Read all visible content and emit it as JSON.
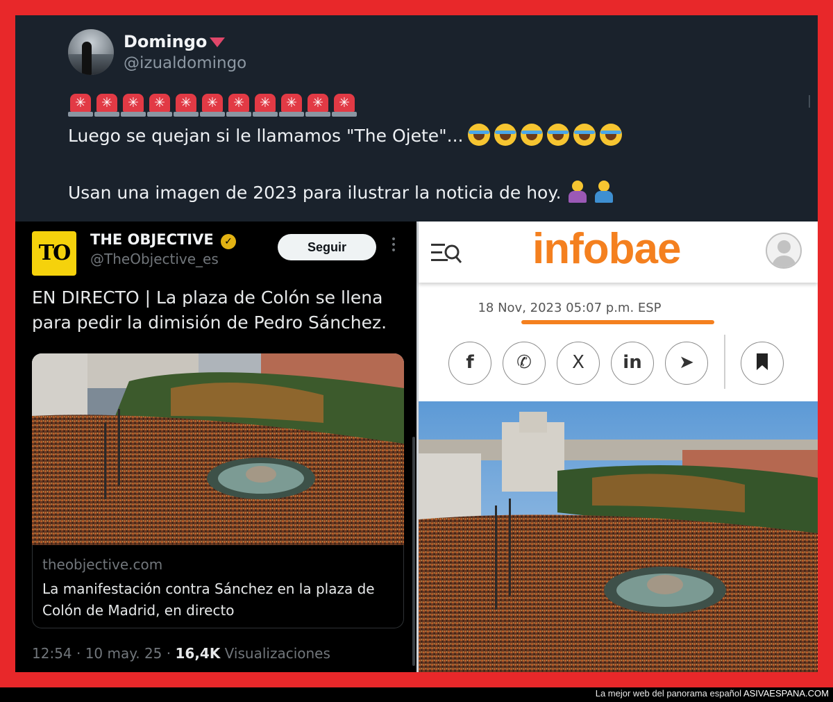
{
  "tweet": {
    "author_name": "Domingo",
    "author_handle": "@izualdomingo",
    "siren_count": 11,
    "line1_text": "Luego se quejan si le llamamos \"The Ojete\"...",
    "laugh_emoji_count": 6,
    "line2_text": "Usan una imagen de 2023 para ilustrar la noticia de hoy."
  },
  "embedded_tweet": {
    "logo_text": "TO",
    "account_name": "THE OBJECTIVE",
    "account_handle": "@TheObjective_es",
    "follow_label": "Seguir",
    "more_icon": "⋮",
    "text": "EN DIRECTO | La plaza de Colón se llena para pedir la dimisión de Pedro Sánchez.",
    "link_domain": "theobjective.com",
    "link_title": "La manifestación contra Sánchez en la plaza de Colón de Madrid, en directo",
    "time_date": "12:54 · 10 may. 25 · ",
    "views_count": "16,4K",
    "views_label": " Visualizaciones"
  },
  "infobae": {
    "logo": "infobae",
    "date": "18 Nov, 2023 05:07 p.m. ESP",
    "share_buttons": [
      {
        "icon": "facebook-icon",
        "glyph": "f"
      },
      {
        "icon": "whatsapp-icon",
        "glyph": "✆"
      },
      {
        "icon": "x-icon",
        "glyph": "X"
      },
      {
        "icon": "linkedin-icon",
        "glyph": "in"
      },
      {
        "icon": "telegram-icon",
        "glyph": "➤"
      }
    ],
    "bookmark_icon": "bookmark-icon"
  },
  "footer": {
    "tagline": "La mejor web del panorama español ",
    "brand": "ASIVAESPANA.COM"
  },
  "colors": {
    "frame_red": "#e8282a",
    "tweet_bg": "#1a222c",
    "infobae_orange": "#f4801f",
    "to_yellow": "#f5d20c"
  }
}
